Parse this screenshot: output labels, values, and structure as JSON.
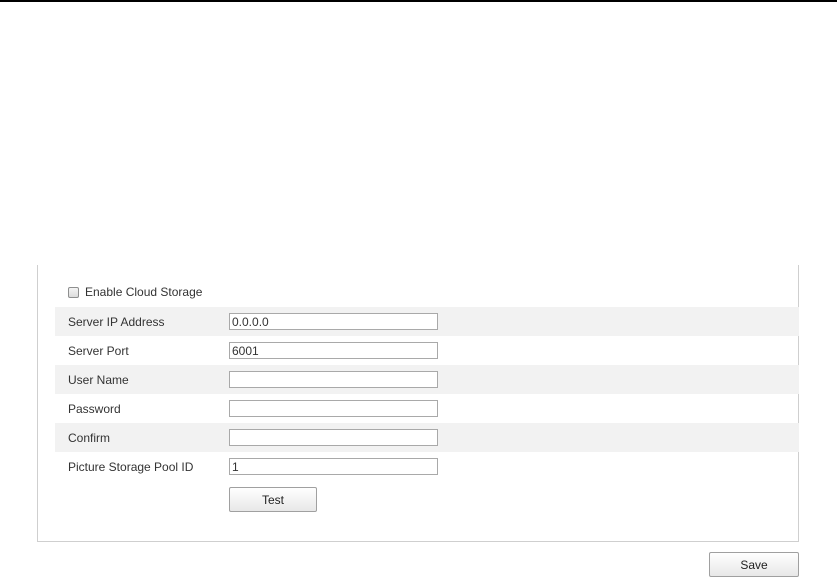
{
  "cloud_storage": {
    "enable_label": "Enable Cloud Storage",
    "enable_checked": false,
    "fields": [
      {
        "label": "Server IP Address",
        "value": "0.0.0.0",
        "shaded": true
      },
      {
        "label": "Server Port",
        "value": "6001",
        "shaded": false
      },
      {
        "label": "User Name",
        "value": "",
        "shaded": true
      },
      {
        "label": "Password",
        "value": "",
        "shaded": false
      },
      {
        "label": "Confirm",
        "value": "",
        "shaded": true
      },
      {
        "label": "Picture Storage Pool ID",
        "value": "1",
        "shaded": false
      }
    ],
    "test_label": "Test"
  },
  "footer": {
    "save_label": "Save"
  }
}
